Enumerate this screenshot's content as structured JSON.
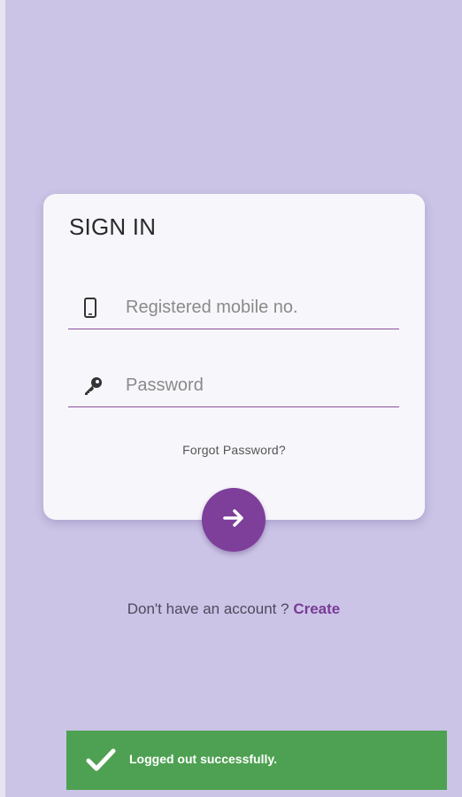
{
  "signin": {
    "title": "SIGN IN",
    "mobile_placeholder": "Registered mobile no.",
    "mobile_value": "",
    "password_placeholder": "Password",
    "password_value": "",
    "forgot_label": "Forgot Password?",
    "submit_icon": "arrow-right-icon"
  },
  "signup": {
    "prompt": "Don't have an account ?",
    "link_label": "Create"
  },
  "toast": {
    "icon": "checkmark-icon",
    "message": "Logged out successfully."
  },
  "colors": {
    "background": "#cbc4e6",
    "card": "#f7f6fb",
    "accent": "#7d3f9a",
    "toast": "#4ea152"
  }
}
